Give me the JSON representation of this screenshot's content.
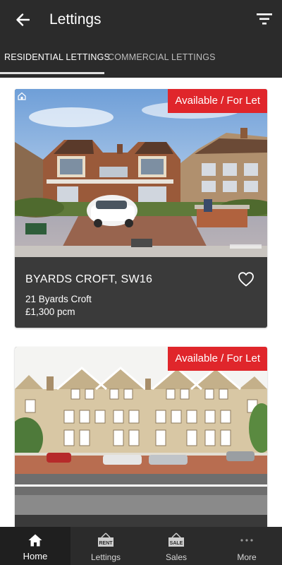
{
  "header": {
    "title": "Lettings",
    "back_icon": "arrow-left-icon",
    "filter_icon": "filter-icon"
  },
  "tabs": [
    {
      "label": "RESIDENTIAL LETTINGS",
      "active": true
    },
    {
      "label": "COMMERCIAL LETTINGS",
      "active": false
    }
  ],
  "listings": [
    {
      "badge": "Available / For Let",
      "title": "BYARDS CROFT, SW16",
      "address": "21 Byards Croft",
      "price": "£1,300 pcm",
      "image_caption": "Semi-detached brick house with white car in driveway",
      "favorite_icon": "heart-outline-icon"
    },
    {
      "badge": "Available / For Let",
      "image_caption": "Row of Victorian gabled terrace houses"
    }
  ],
  "bottom_nav": [
    {
      "label": "Home",
      "icon": "home-icon",
      "active": true
    },
    {
      "label": "Lettings",
      "icon": "rent-sign-icon",
      "icon_text": "RENT",
      "active": false
    },
    {
      "label": "Sales",
      "icon": "sale-sign-icon",
      "icon_text": "SALE",
      "active": false
    },
    {
      "label": "More",
      "icon": "more-dots-icon",
      "active": false
    }
  ],
  "colors": {
    "header_bg": "#2b2b2b",
    "card_bg": "#3a3a3a",
    "badge_bg": "#e0262b",
    "nav_bg": "#2b2b2b"
  }
}
